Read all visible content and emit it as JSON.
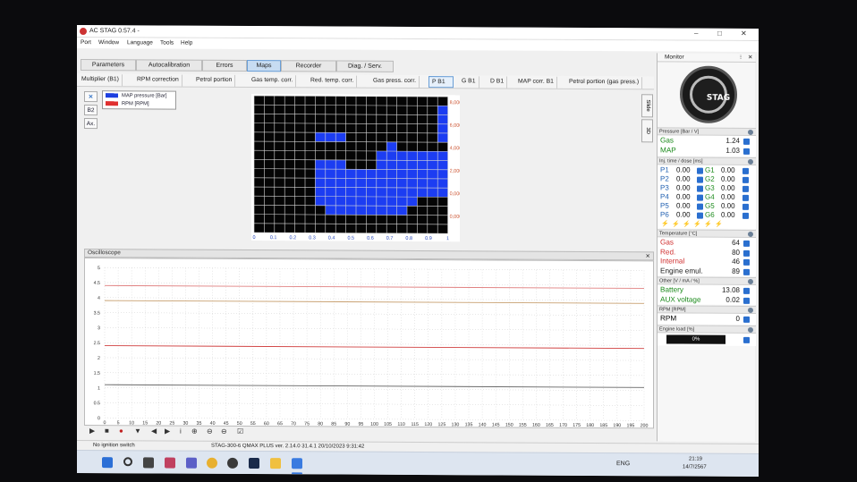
{
  "window": {
    "title": "AC STAG 0.57.4 -",
    "controls": [
      "–",
      "□",
      "✕"
    ]
  },
  "menu": [
    "Port",
    "Window",
    "Language",
    "Tools",
    "Help"
  ],
  "main_tabs": [
    "Parameters",
    "Autocalibration",
    "Errors",
    "Maps",
    "Recorder",
    "Diag. / Serv."
  ],
  "active_main_tab": "Maps",
  "sub_tabs": [
    "Multiplier (B1)",
    "RPM correction",
    "Petrol portion",
    "Gas temp. corr.",
    "Red. temp. corr.",
    "Gas press. corr.",
    "P B1",
    "G B1",
    "D B1",
    "MAP corr. B1",
    "Petrol portion (gas press.)"
  ],
  "active_sub_tab": "P B1",
  "left_buttons": [
    "✕",
    "B2",
    "Ax."
  ],
  "legend": [
    {
      "label": "MAP pressure [Bar]",
      "color": "#1d3fe0"
    },
    {
      "label": "RPM [RPM]",
      "color": "#e03030"
    }
  ],
  "side_tabs": [
    "Slide",
    "3D"
  ],
  "map": {
    "x_ticks": [
      "0",
      "0.1",
      "0.2",
      "0.3",
      "0.4",
      "0.5",
      "0.6",
      "0.7",
      "0.8",
      "0.9",
      "1"
    ],
    "y_ticks": [
      "8,000",
      "6,000",
      "4,000",
      "2,000",
      "0,000",
      "0,000"
    ],
    "cols": 19,
    "rows": 15,
    "filled_cells": [
      [
        18,
        1
      ],
      [
        18,
        2
      ],
      [
        18,
        3
      ],
      [
        18,
        4
      ],
      [
        6,
        4
      ],
      [
        7,
        4
      ],
      [
        8,
        4
      ],
      [
        13,
        5
      ],
      [
        12,
        6
      ],
      [
        13,
        6
      ],
      [
        14,
        6
      ],
      [
        15,
        6
      ],
      [
        16,
        6
      ],
      [
        17,
        6
      ],
      [
        18,
        6
      ],
      [
        6,
        7
      ],
      [
        7,
        7
      ],
      [
        8,
        7
      ],
      [
        12,
        7
      ],
      [
        13,
        7
      ],
      [
        14,
        7
      ],
      [
        15,
        7
      ],
      [
        16,
        7
      ],
      [
        17,
        7
      ],
      [
        18,
        7
      ],
      [
        6,
        8
      ],
      [
        7,
        8
      ],
      [
        8,
        8
      ],
      [
        9,
        8
      ],
      [
        10,
        8
      ],
      [
        11,
        8
      ],
      [
        12,
        8
      ],
      [
        13,
        8
      ],
      [
        14,
        8
      ],
      [
        15,
        8
      ],
      [
        16,
        8
      ],
      [
        17,
        8
      ],
      [
        18,
        8
      ],
      [
        6,
        9
      ],
      [
        7,
        9
      ],
      [
        8,
        9
      ],
      [
        9,
        9
      ],
      [
        10,
        9
      ],
      [
        11,
        9
      ],
      [
        12,
        9
      ],
      [
        13,
        9
      ],
      [
        14,
        9
      ],
      [
        15,
        9
      ],
      [
        16,
        9
      ],
      [
        17,
        9
      ],
      [
        18,
        9
      ],
      [
        6,
        10
      ],
      [
        7,
        10
      ],
      [
        8,
        10
      ],
      [
        9,
        10
      ],
      [
        10,
        10
      ],
      [
        11,
        10
      ],
      [
        12,
        10
      ],
      [
        13,
        10
      ],
      [
        14,
        10
      ],
      [
        15,
        10
      ],
      [
        16,
        10
      ],
      [
        17,
        10
      ],
      [
        18,
        10
      ],
      [
        6,
        11
      ],
      [
        7,
        11
      ],
      [
        8,
        11
      ],
      [
        9,
        11
      ],
      [
        10,
        11
      ],
      [
        11,
        11
      ],
      [
        12,
        11
      ],
      [
        13,
        11
      ],
      [
        14,
        11
      ],
      [
        15,
        11
      ],
      [
        7,
        12
      ],
      [
        8,
        12
      ],
      [
        9,
        12
      ],
      [
        10,
        12
      ],
      [
        11,
        12
      ],
      [
        12,
        12
      ],
      [
        13,
        12
      ],
      [
        14,
        12
      ]
    ]
  },
  "oscilloscope": {
    "title": "Oscilloscope",
    "close": "✕",
    "y_ticks": [
      "5",
      "4.5",
      "4",
      "3.5",
      "3",
      "2.5",
      "2",
      "1.5",
      "1",
      "0.5",
      "0"
    ],
    "x_ticks": [
      "0",
      "5",
      "10",
      "15",
      "20",
      "25",
      "30",
      "35",
      "40",
      "45",
      "50",
      "55",
      "60",
      "65",
      "70",
      "75",
      "80",
      "85",
      "90",
      "95",
      "100",
      "105",
      "110",
      "115",
      "120",
      "125",
      "130",
      "135",
      "140",
      "145",
      "150",
      "155",
      "160",
      "165",
      "170",
      "175",
      "180",
      "185",
      "190",
      "195",
      "200"
    ],
    "traces": [
      {
        "y": 4.4,
        "color": "#e08080"
      },
      {
        "y": 3.9,
        "color": "#c8a070"
      },
      {
        "y": 2.4,
        "color": "#d04040"
      },
      {
        "y": 1.1,
        "color": "#666666"
      }
    ],
    "toolbar": [
      "▶",
      "■",
      "●",
      "▼",
      "◀",
      "▶",
      "i",
      "⊕",
      "⊖",
      "⊖",
      "☑"
    ]
  },
  "status": {
    "left": "No ignition switch",
    "center": "STAG-300-6 QMAX PLUS  ver. 2.14.0  31.4.1  20/10/2023 9:31:42"
  },
  "monitor": {
    "title": "Monitor",
    "logo_text": "STAG",
    "pressure_header": "Pressure [Bar / V]",
    "pressure": [
      {
        "label": "Gas",
        "value": "1.24",
        "color": "#1b8a1b"
      },
      {
        "label": "MAP",
        "value": "1.03",
        "color": "#1b8a1b"
      }
    ],
    "inj_header": "Inj. time / dose [ms]",
    "injectors": [
      {
        "p": "P1",
        "pv": "0.00",
        "g": "G1",
        "gv": "0.00"
      },
      {
        "p": "P2",
        "pv": "0.00",
        "g": "G2",
        "gv": "0.00"
      },
      {
        "p": "P3",
        "pv": "0.00",
        "g": "G3",
        "gv": "0.00"
      },
      {
        "p": "P4",
        "pv": "0.00",
        "g": "G4",
        "gv": "0.00"
      },
      {
        "p": "P5",
        "pv": "0.00",
        "g": "G5",
        "gv": "0.00"
      },
      {
        "p": "P6",
        "pv": "0.00",
        "g": "G6",
        "gv": "0.00"
      }
    ],
    "temp_header": "Temperature [°C]",
    "temps": [
      {
        "label": "Gas",
        "value": "64",
        "color": "#d03030"
      },
      {
        "label": "Red.",
        "value": "80",
        "color": "#d03030"
      },
      {
        "label": "Internal",
        "value": "46",
        "color": "#d03030"
      },
      {
        "label": "Engine emul.",
        "value": "89",
        "color": "#222222"
      }
    ],
    "other_header": "Other [V / mA / %]",
    "other": [
      {
        "label": "Battery",
        "value": "13.08",
        "color": "#1b8a1b"
      },
      {
        "label": "AUX voltage",
        "value": "0.02",
        "color": "#1b8a1b"
      }
    ],
    "rpm_header": "RPM [RPM]",
    "rpm": {
      "label": "RPM",
      "value": "0",
      "color": "#d03030"
    },
    "load_header": "Engine load [%]",
    "load": "0%"
  },
  "taskbar": {
    "lang": "ENG",
    "time": "21:19",
    "date": "14/7/2567"
  }
}
